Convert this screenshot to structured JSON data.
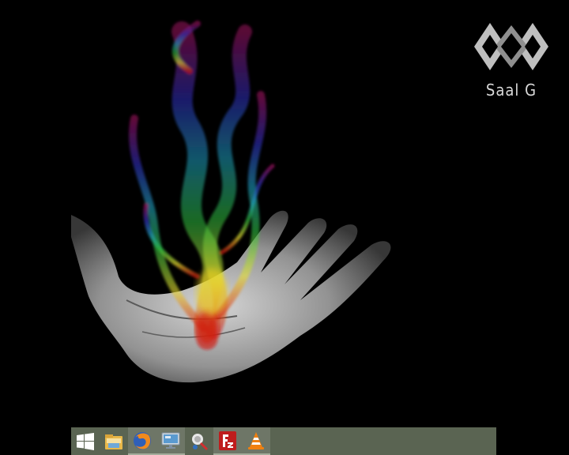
{
  "desktop": {
    "watermark_text": "Saal G",
    "wallpaper_icon": "rainbow-smoke-hand"
  },
  "taskbar": {
    "color": "#5a6452",
    "items": [
      {
        "icon": "windows-start-icon",
        "active": false
      },
      {
        "icon": "file-explorer-icon",
        "active": false
      },
      {
        "icon": "firefox-icon",
        "active": true
      },
      {
        "icon": "remote-desktop-icon",
        "active": true
      },
      {
        "icon": "connection-tool-icon",
        "active": false
      },
      {
        "icon": "filezilla-icon",
        "active": true
      },
      {
        "icon": "vlc-icon",
        "active": true
      }
    ]
  }
}
